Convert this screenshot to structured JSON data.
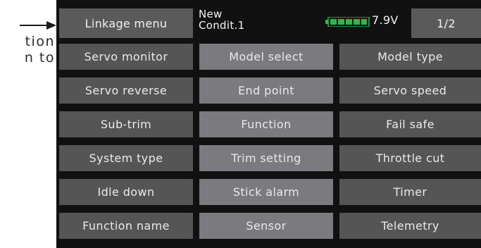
{
  "margin_text": {
    "line1": "tion",
    "line2": "n to"
  },
  "header": {
    "menu_label": "Linkage menu",
    "condition_line1": "New",
    "condition_line2": "Condit.1",
    "voltage": "7.9V",
    "page": "1/2",
    "battery_color": "#2fb84a"
  },
  "menu": {
    "rows": [
      [
        "Servo monitor",
        "Model select",
        "Model type"
      ],
      [
        "Servo reverse",
        "End point",
        "Servo speed"
      ],
      [
        "Sub-trim",
        "Function",
        "Fail safe"
      ],
      [
        "System type",
        "Trim setting",
        "Throttle cut"
      ],
      [
        "Idle down",
        "Stick alarm",
        "Timer"
      ],
      [
        "Function name",
        "Sensor",
        "Telemetry"
      ]
    ]
  }
}
